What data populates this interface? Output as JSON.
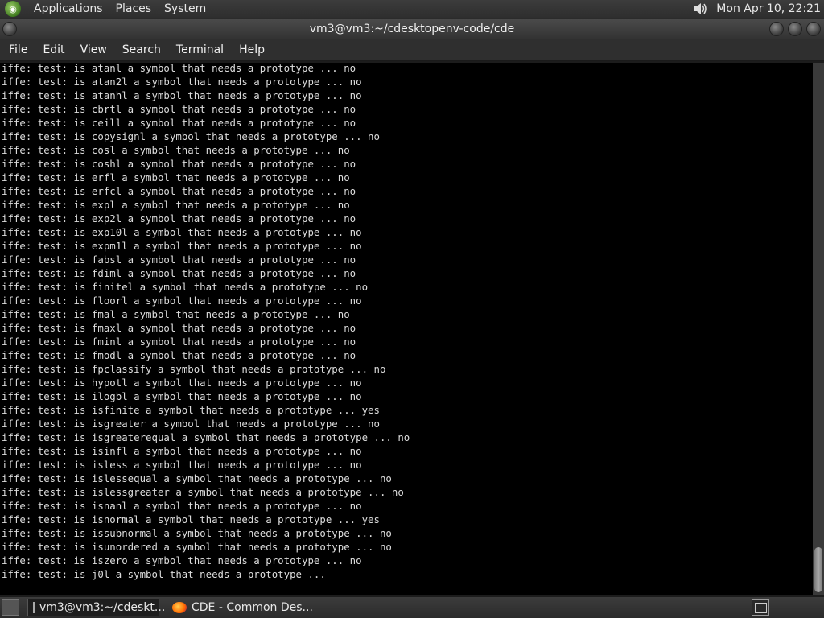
{
  "top_panel": {
    "menus": [
      "Applications",
      "Places",
      "System"
    ],
    "clock": "Mon Apr 10, 22:21"
  },
  "window": {
    "title": "vm3@vm3:~/cdesktopenv-code/cde",
    "menus": [
      "File",
      "Edit",
      "View",
      "Search",
      "Terminal",
      "Help"
    ]
  },
  "terminal": {
    "lines": [
      "iffe: test: is atanl a symbol that needs a prototype ... no",
      "iffe: test: is atan2l a symbol that needs a prototype ... no",
      "iffe: test: is atanhl a symbol that needs a prototype ... no",
      "iffe: test: is cbrtl a symbol that needs a prototype ... no",
      "iffe: test: is ceill a symbol that needs a prototype ... no",
      "iffe: test: is copysignl a symbol that needs a prototype ... no",
      "iffe: test: is cosl a symbol that needs a prototype ... no",
      "iffe: test: is coshl a symbol that needs a prototype ... no",
      "iffe: test: is erfl a symbol that needs a prototype ... no",
      "iffe: test: is erfcl a symbol that needs a prototype ... no",
      "iffe: test: is expl a symbol that needs a prototype ... no",
      "iffe: test: is exp2l a symbol that needs a prototype ... no",
      "iffe: test: is exp10l a symbol that needs a prototype ... no",
      "iffe: test: is expm1l a symbol that needs a prototype ... no",
      "iffe: test: is fabsl a symbol that needs a prototype ... no",
      "iffe: test: is fdiml a symbol that needs a prototype ... no",
      "iffe: test: is finitel a symbol that needs a prototype ... no",
      "iffe: test: is floorl a symbol that needs a prototype ... no",
      "iffe: test: is fmal a symbol that needs a prototype ... no",
      "iffe: test: is fmaxl a symbol that needs a prototype ... no",
      "iffe: test: is fminl a symbol that needs a prototype ... no",
      "iffe: test: is fmodl a symbol that needs a prototype ... no",
      "iffe: test: is fpclassify a symbol that needs a prototype ... no",
      "iffe: test: is hypotl a symbol that needs a prototype ... no",
      "iffe: test: is ilogbl a symbol that needs a prototype ... no",
      "iffe: test: is isfinite a symbol that needs a prototype ... yes",
      "iffe: test: is isgreater a symbol that needs a prototype ... no",
      "iffe: test: is isgreaterequal a symbol that needs a prototype ... no",
      "iffe: test: is isinfl a symbol that needs a prototype ... no",
      "iffe: test: is isless a symbol that needs a prototype ... no",
      "iffe: test: is islessequal a symbol that needs a prototype ... no",
      "iffe: test: is islessgreater a symbol that needs a prototype ... no",
      "iffe: test: is isnanl a symbol that needs a prototype ... no",
      "iffe: test: is isnormal a symbol that needs a prototype ... yes",
      "iffe: test: is issubnormal a symbol that needs a prototype ... no",
      "iffe: test: is isunordered a symbol that needs a prototype ... no",
      "iffe: test: is iszero a symbol that needs a prototype ... no",
      "iffe: test: is j0l a symbol that needs a prototype ..."
    ]
  },
  "taskbar": {
    "tasks": [
      "vm3@vm3:~/cdeskt...",
      "CDE - Common Des..."
    ]
  }
}
